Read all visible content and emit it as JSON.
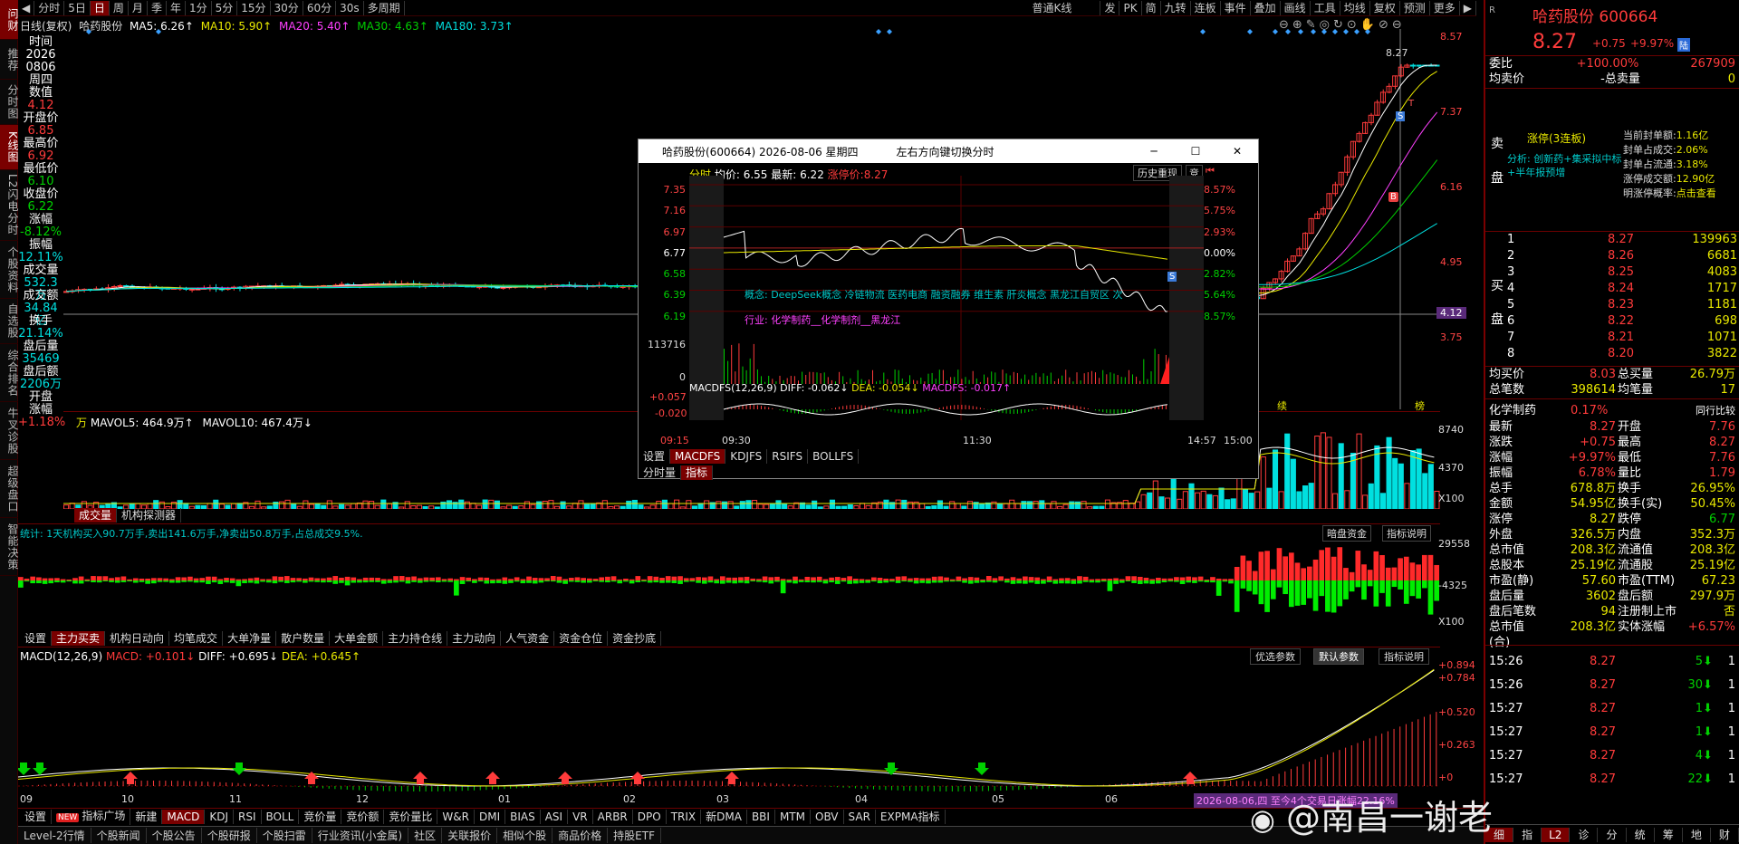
{
  "window": {
    "app_icon": "同花顺"
  },
  "leftbar": {
    "items": [
      "问财",
      "推荐",
      "分时图",
      "K线图",
      "L2闪电分时",
      "个股资料",
      "自选股",
      "综合排名",
      "牛叉诊股",
      "超级盘口",
      "智能决策"
    ]
  },
  "topbar": {
    "items": [
      "分时",
      "5日",
      "日",
      "周",
      "月",
      "季",
      "年",
      "1分",
      "5分",
      "15分",
      "30分",
      "60分",
      "30s",
      "多周期"
    ],
    "active": "日",
    "right_items": [
      "普通K线",
      "发",
      "PK",
      "简",
      "九转",
      "连板",
      "事件",
      "叠加",
      "画线",
      "工具",
      "均线",
      "复权",
      "预测",
      "更多"
    ]
  },
  "chart_header": {
    "label": "日线(复权)",
    "stock": "哈药股份",
    "ma5": "MA5: 6.26↑",
    "ma10": "MA10: 5.90↑",
    "ma20": "MA20: 5.40↑",
    "ma30": "MA30: 4.63↑",
    "ma180": "MA180: 3.73↑"
  },
  "info": {
    "time_label": "时间",
    "date1": "2026",
    "date2": "0806",
    "weekday": "周四",
    "value_label": "数值",
    "value": "4.12",
    "open_label": "开盘价",
    "open": "6.85",
    "high_label": "最高价",
    "high": "6.92",
    "low_label": "最低价",
    "low": "6.10",
    "close_label": "收盘价",
    "close": "6.22",
    "chg_label": "涨幅",
    "chg": "-8.12%",
    "amp_label": "振幅",
    "amp": "12.11%",
    "vol_label": "成交量",
    "vol": "532.3万",
    "amt_label": "成交额",
    "amt": "34.84亿",
    "turn_label": "换手",
    "turn": "21.14%",
    "after_vol_label": "盘后量",
    "after_vol": "35469",
    "after_amt_label": "盘后额",
    "after_amt": "2206万",
    "open2_label": "开盘",
    "chg2_label": "涨幅",
    "chg2": "+1.18%"
  },
  "price_axis": [
    "8.57",
    "7.37",
    "6.16",
    "4.95",
    "4.12",
    "3.75"
  ],
  "price_tag_top": "8.27",
  "kline_marks": {
    "b": "B",
    "s": "S",
    "t": "T",
    "xu": "续",
    "bang": "榜"
  },
  "vol": {
    "label": "万",
    "mavol5": "MAVOL5: 464.9万↑",
    "mavol10": "MAVOL10: 467.4万↓",
    "axis": [
      "8740",
      "4370",
      "X100"
    ],
    "tabs": [
      "成交量",
      "机构探测器"
    ]
  },
  "fund": {
    "text": "统计: 1天机构买入90.7万手,卖出141.6万手,净卖出50.8万手,占总成交9.5%.",
    "btn1": "暗盘资金",
    "btn2": "指标说明",
    "axis": [
      "29558",
      "-4325",
      "X100"
    ],
    "tabs": [
      "设置",
      "主力买卖",
      "机构日动向",
      "均笔成交",
      "大单净量",
      "散户数量",
      "大单金额",
      "主力持仓线",
      "主力动向",
      "人气资金",
      "资金仓位",
      "资金抄底"
    ]
  },
  "macd": {
    "label": "MACD(12,26,9)",
    "macd": "MACD: +0.101↓",
    "diff": "DIFF: +0.695↓",
    "dea": "DEA: +0.645↑",
    "btn1": "优选参数",
    "btn2": "默认参数",
    "btn3": "指标说明",
    "axis": [
      "+0.894",
      "+0.784",
      "+0.520",
      "+0.263",
      "+0"
    ],
    "months": [
      "09",
      "10",
      "11",
      "12",
      "01",
      "02",
      "03",
      "04",
      "05",
      "06"
    ],
    "highlight": "2026-08-06,四 至今4个交易日涨幅22.16%"
  },
  "bottom_tabs": [
    "设置",
    "指标广场",
    "新建",
    "MACD",
    "KDJ",
    "RSI",
    "BOLL",
    "竞价量",
    "竞价额",
    "竞价量比",
    "W&R",
    "DMI",
    "BIAS",
    "ASI",
    "VR",
    "ARBR",
    "DPO",
    "TRIX",
    "新DMA",
    "BBI",
    "MTM",
    "OBV",
    "SAR",
    "EXPMA指标"
  ],
  "bottom_tabs_badge": "NEW",
  "status_bar": [
    "Level-2行情",
    "个股新闻",
    "个股公告",
    "个股研报",
    "个股扫雷",
    "行业资讯(小金属)",
    "社区",
    "关联报价",
    "相似个股",
    "商品价格",
    "持股ETF"
  ],
  "popup": {
    "title": "哈药股份(600664) 2026-08-06 星期四",
    "hint": "左右方向键切换分时",
    "header_a": "分时",
    "avg": "均价: 6.55",
    "latest": "最新: 6.22",
    "limit": "涨停价:8.27",
    "replay": "历史重现",
    "bid": "竞",
    "price_axis": [
      "7.35",
      "7.16",
      "6.97",
      "6.77",
      "6.58",
      "6.39",
      "6.19",
      "113716",
      "0"
    ],
    "pct_axis": [
      "8.57%",
      "5.75%",
      "2.93%",
      "0.00%",
      "2.82%",
      "5.64%",
      "8.57%"
    ],
    "concept": "概念: DeepSeek概念  冷链物流  医药电商  融资融券  维生素  肝炎概念  黑龙江自贸区  次",
    "industry": "行业: 化学制药__化学制剂__黑龙江",
    "s_mark": "S",
    "macdfs": "MACDFS(12,26,9)",
    "pdiff": "DIFF: -0.062↓",
    "pdea": "DEA: -0.054↓",
    "pmacdfs": "MACDFS: -0.017↑",
    "macd_axis": [
      "+0.057",
      "-0.020"
    ],
    "times": [
      "09:15",
      "09:30",
      "11:30",
      "14:57",
      "15:00"
    ],
    "tabs": [
      "设置",
      "MACDFS",
      "KDJFS",
      "RSIFS",
      "BOLLFS"
    ],
    "tabs2": [
      "分时量",
      "指标"
    ]
  },
  "right": {
    "name": "哈药股份 600664",
    "price": "8.27",
    "change": "+0.75",
    "pct": "+9.97%",
    "tag": "陆",
    "weibi_label": "委比",
    "weibi": "+100.00%",
    "weibi_v": "267909",
    "jmj_label": "均卖价",
    "zmj": "-总卖量",
    "zmj_v": "0",
    "limit_status": "涨停(3连板)",
    "analysis": "分析: 创新药+集采拟中标+半年报预增",
    "lfields": [
      [
        "当前封单额:",
        "1.16亿"
      ],
      [
        "封单占成交:",
        "2.06%"
      ],
      [
        "封单占流通:",
        "3.18%"
      ],
      [
        "涨停成交额:",
        "12.90亿"
      ],
      [
        "明涨停概率:",
        "点击查看"
      ]
    ],
    "sell_label": "卖",
    "pan_label": "盘",
    "buy_label": "买",
    "buy_pan": "盘",
    "bids": [
      [
        "1",
        "8.27",
        "139963"
      ],
      [
        "2",
        "8.26",
        "6681"
      ],
      [
        "3",
        "8.25",
        "4083"
      ],
      [
        "4",
        "8.24",
        "1717"
      ],
      [
        "5",
        "8.23",
        "1181"
      ],
      [
        "6",
        "8.22",
        "698"
      ],
      [
        "7",
        "8.21",
        "1071"
      ],
      [
        "8",
        "8.20",
        "3822"
      ]
    ],
    "avg_buy_label": "均买价",
    "avg_buy": "8.03",
    "total_buy_label": "总买量",
    "total_buy": "26.79万",
    "total_ticks_label": "总笔数",
    "total_ticks": "398614",
    "avg_tick_label": "均笔量",
    "avg_tick": "17",
    "industry": "化学制药",
    "industry_pct": "0.17%",
    "industry_btn": "同行比较",
    "stats": [
      [
        "最新",
        "8.27",
        "开盘",
        "7.76"
      ],
      [
        "涨跌",
        "+0.75",
        "最高",
        "8.27"
      ],
      [
        "涨幅",
        "+9.97%",
        "最低",
        "7.76"
      ],
      [
        "振幅",
        "6.78%",
        "量比",
        "1.79"
      ],
      [
        "总手",
        "678.8万",
        "换手",
        "26.95%"
      ],
      [
        "金额",
        "54.95亿",
        "换手(实)",
        "50.45%"
      ],
      [
        "涨停",
        "8.27",
        "跌停",
        "6.77"
      ],
      [
        "外盘",
        "326.5万",
        "内盘",
        "352.3万"
      ],
      [
        "总市值",
        "208.3亿",
        "流通值",
        "208.3亿"
      ],
      [
        "总股本",
        "25.19亿",
        "流通股",
        "25.19亿"
      ],
      [
        "市盈(静)",
        "57.60",
        "市盈(TTM)",
        "67.23"
      ],
      [
        "盘后量",
        "3602",
        "盘后额",
        "297.9万"
      ],
      [
        "盘后笔数",
        "94",
        "注册制上市",
        "否"
      ],
      [
        "总市值(合)",
        "208.3亿",
        "实体涨幅",
        "+6.57%"
      ]
    ],
    "ticks": [
      [
        "15:26",
        "8.27",
        "5",
        "1"
      ],
      [
        "15:26",
        "8.27",
        "30",
        "1"
      ],
      [
        "15:27",
        "8.27",
        "1",
        "1"
      ],
      [
        "15:27",
        "8.27",
        "1",
        "1"
      ],
      [
        "15:27",
        "8.27",
        "4",
        "1"
      ],
      [
        "15:27",
        "8.27",
        "22",
        "1"
      ]
    ],
    "bottom_tabs": [
      "细",
      "指",
      "L2",
      "诊",
      "分",
      "统",
      "筹",
      "地",
      "财"
    ]
  },
  "watermark": "@南昌一谢老"
}
